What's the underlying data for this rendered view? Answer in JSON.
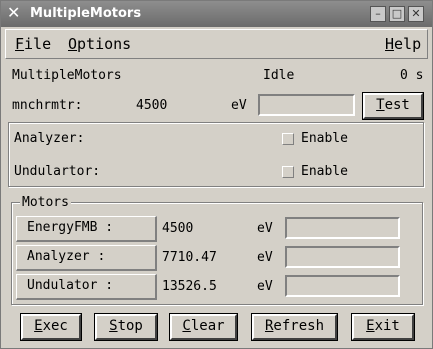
{
  "window": {
    "title": "MultipleMotors",
    "buttons": {
      "minimize": "–",
      "maximize": "□",
      "close": "✕"
    }
  },
  "menu": {
    "file_rest": "ile",
    "file_key": "F",
    "options_rest": "ptions",
    "options_key": "O",
    "help_rest": "elp",
    "help_key": "H"
  },
  "status": {
    "app_name": "MultipleMotors",
    "state": "Idle",
    "elapsed": "0 s"
  },
  "mnchrmtr": {
    "label": "mnchrmtr:",
    "value": "4500",
    "unit": "eV",
    "input_value": "",
    "test_key": "T",
    "test_rest": "est"
  },
  "options": [
    {
      "label": "Analyzer:",
      "enable_label": "Enable",
      "checked": false
    },
    {
      "label": "Undulartor:",
      "enable_label": "Enable",
      "checked": false
    }
  ],
  "motors": {
    "legend": "Motors",
    "rows": [
      {
        "label": "EnergyFMB :",
        "value": "4500",
        "unit": "eV",
        "input_value": ""
      },
      {
        "label": "Analyzer :",
        "value": "7710.47",
        "unit": "eV",
        "input_value": ""
      },
      {
        "label": "Undulator :",
        "value": "13526.5",
        "unit": "eV",
        "input_value": ""
      }
    ]
  },
  "buttons": {
    "exec_key": "E",
    "exec_rest": "xec",
    "stop_key": "S",
    "stop_rest": "top",
    "clear_key": "C",
    "clear_rest": "lear",
    "refresh_key": "R",
    "refresh_rest": "efresh",
    "exit_key": "E",
    "exit_rest": "xit"
  }
}
